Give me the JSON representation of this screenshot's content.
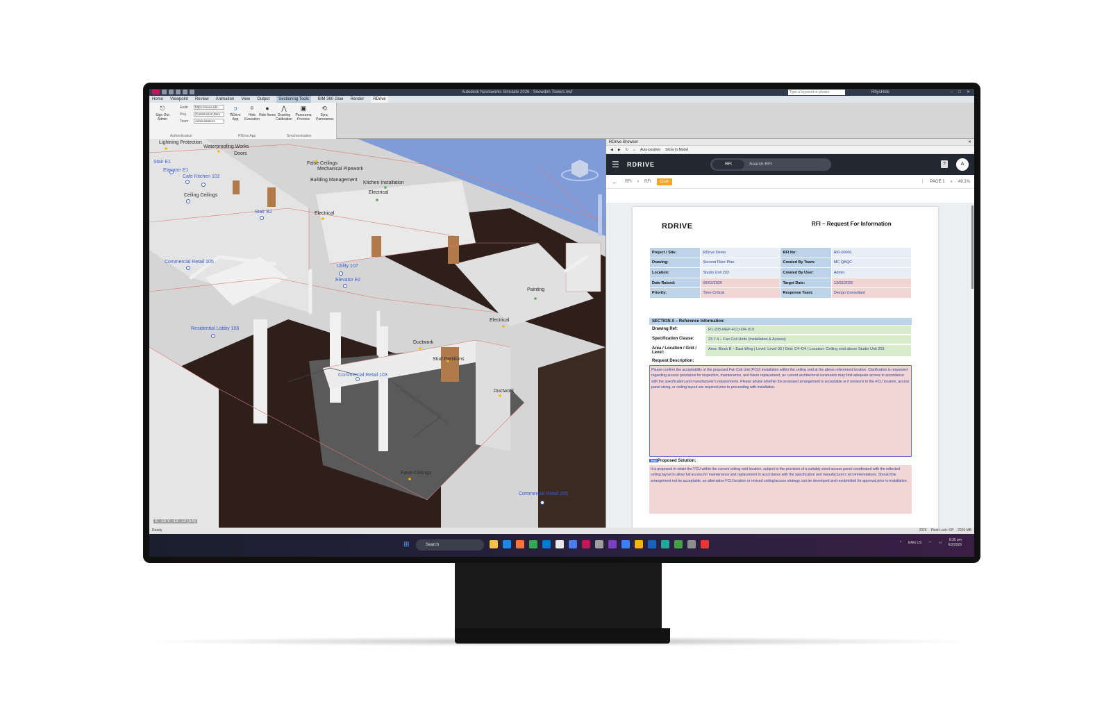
{
  "window": {
    "title": "Autodesk Navisworks Simulate 2026 - Snowdon Towers.nwf",
    "search_placeholder": "Type a keyword or phrase",
    "user": "RhysHole"
  },
  "menu_tabs": [
    "Home",
    "Viewpoint",
    "Review",
    "Animation",
    "View",
    "Output",
    "Sectioning Tools",
    "BIM 360 Glue",
    "Render",
    "RDrive"
  ],
  "ribbon": {
    "sign_out": "Sign Out Admin",
    "fields": [
      {
        "label": "Endtr",
        "value": "https://mena.rdri..."
      },
      {
        "label": "Proj",
        "value": "Construction Dem"
      },
      {
        "label": "Team",
        "value": "Administrators"
      }
    ],
    "buttons": [
      "RDrive App",
      "Hide Evacution",
      "Hide Items",
      "Drawing Calibration",
      "Panorama Preview",
      "Sync Panoramas"
    ],
    "groups": [
      "Authentication",
      "RDrive App",
      "Synchronisation"
    ]
  },
  "viewport": {
    "labels": [
      "Lightning Protection",
      "Waterproofing Works",
      "Doors",
      "Stair E1",
      "Elevator E1",
      "Cafe Kitchen 102",
      "False Ceilings",
      "Mechanical Pipework",
      "Building Management",
      "Kitchen Installation",
      "Electrical",
      "Ceiling Ceilings",
      "Stair B2",
      "Electrical",
      "Commercial Retail 105",
      "Utility 107",
      "Elevator E2",
      "Painting",
      "Residential Lobby 106",
      "Electrical",
      "Ductwork",
      "Stud Partitions",
      "Commercial Retail 103",
      "Ductwork",
      "False Ceilings",
      "Commercial Retail 209"
    ],
    "coordinates": "X: -23 Y: -13 : 12 (5.5)"
  },
  "browser": {
    "title": "RDrive Browser",
    "toolbar": [
      "Auto-position",
      "Show In Model"
    ],
    "brand": "RDRIVE",
    "tab": "RFI",
    "search_placeholder": "Search RFI",
    "avatar": "A",
    "help_icon": "?",
    "crumbs": [
      "RFI",
      "RFI"
    ],
    "status": "Draft",
    "page_label": "PAGE 1",
    "zoom": "49.1%"
  },
  "document": {
    "logo": "RDRIVE",
    "title": "RFI – Request For Information",
    "info_rows": [
      {
        "k1": "Project / Site:",
        "v1": "RDrive Demo",
        "k2": "RFI No:",
        "v2": "RFI-00001"
      },
      {
        "k1": "Drawing:",
        "v1": "Second Floor Plan",
        "k2": "Created By Team:",
        "v2": "MC QAQC"
      },
      {
        "k1": "Location:",
        "v1": "Studio Unit 203",
        "k2": "Created By User:",
        "v2": "Admin"
      },
      {
        "k1": "Date Raised:",
        "v1": "06/02/2026",
        "k2": "Target Date:",
        "v2": "13/02/2026"
      },
      {
        "k1": "Priority:",
        "v1": "Time-Critical",
        "k2": "Response Team:",
        "v2": "Design Consultant"
      }
    ],
    "section_a": {
      "heading": "SECTION A – Reference Information:",
      "drawing_ref_label": "Drawing Ref:",
      "drawing_ref": "R1-Z05-MEP-FCU-DR-019",
      "spec_label": "Specification Clause:",
      "spec": "23.7.4 – Fan Coil Units (Installation & Access)",
      "area_label": "Area / Location / Grid / Level:",
      "area": "Area: Block B – East Wing | Level: Level 03 | Grid: C4–D4 | Location: Ceiling void above Studio Unit 203",
      "desc_label": "Request Description:",
      "desc": "Please confirm the acceptability of the proposed Fan Coil Unit (FCU) installation within the ceiling void at the above referenced location. Clarification is requested regarding access provisions for inspection, maintenance, and future replacement, as current architectural constraints may limit adequate access in accordance with the specification and manufacturer's requirements. Please advise whether the proposed arrangement is acceptable or if revisions to the FCU location, access panel sizing, or ceiling layout are required prior to proceeding with installation.",
      "text_tag": "Text",
      "sol_label": "Proposed Solution:",
      "sol": "It is proposed to retain the FCU within the current ceiling void location, subject to the provision of a suitably sized access panel coordinated with the reflected ceiling layout to allow full access for maintenance and replacement in accordance with the specification and manufacturer's recommendations. Should this arrangement not be acceptable, an alternative FCU location or revised ceiling/access strategy can be developed and resubmitted for approval prior to installation."
    }
  },
  "statusbar": {
    "left": "Ready",
    "right": [
      "2026",
      "Pivot Lock: Off",
      "2026 MB"
    ]
  },
  "taskbar": {
    "search": "Search",
    "lang": "ENG US",
    "time": "8:35 pm",
    "date": "6/2/2026",
    "icon_colors": [
      "#f2c14e",
      "#1e88e5",
      "#ff7043",
      "#34a853",
      "#0078d4",
      "#e8e8e8",
      "#4b7bec",
      "#c2185b",
      "#9e9e9e",
      "#7b3fbf",
      "#3b82f6",
      "#f4b400",
      "#1565c0",
      "#26a69a",
      "#43a047",
      "#8e8e8e",
      "#e53935"
    ]
  }
}
